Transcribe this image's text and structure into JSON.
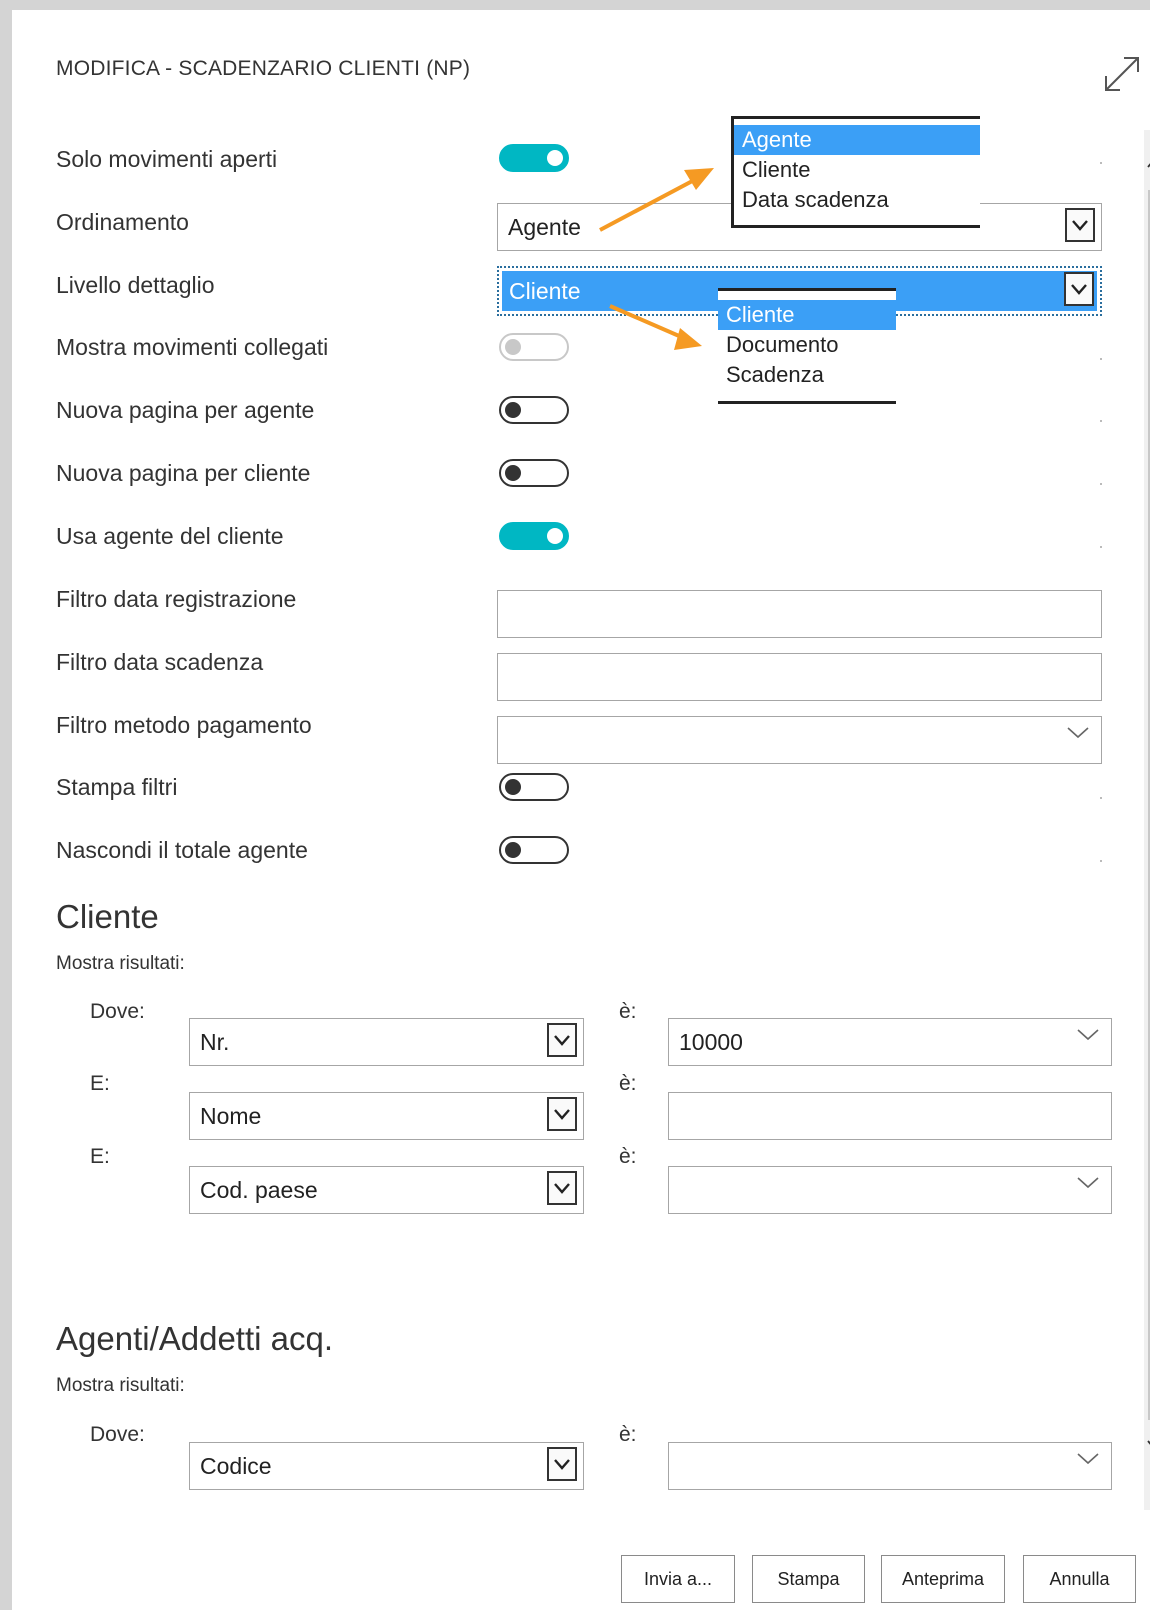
{
  "dialog": {
    "title": "MODIFICA - SCADENZARIO CLIENTI (NP)"
  },
  "options": {
    "solo_movimenti_aperti": {
      "label": "Solo movimenti aperti",
      "state": "on"
    },
    "ordinamento": {
      "label": "Ordinamento",
      "value": "Agente",
      "options": [
        "Agente",
        "Cliente",
        "Data scadenza"
      ],
      "highlighted": "Agente"
    },
    "livello_dettaglio": {
      "label": "Livello dettaglio",
      "value": "Cliente",
      "options": [
        "Cliente",
        "Documento",
        "Scadenza"
      ],
      "highlighted": "Cliente"
    },
    "mostra_movimenti_collegati": {
      "label": "Mostra movimenti collegati",
      "state": "disabled"
    },
    "nuova_pagina_per_agente": {
      "label": "Nuova pagina per agente",
      "state": "off"
    },
    "nuova_pagina_per_cliente": {
      "label": "Nuova pagina per cliente",
      "state": "off"
    },
    "usa_agente_del_cliente": {
      "label": "Usa agente del cliente",
      "state": "on"
    },
    "filtro_data_registrazione": {
      "label": "Filtro data registrazione",
      "value": ""
    },
    "filtro_data_scadenza": {
      "label": "Filtro data scadenza",
      "value": ""
    },
    "filtro_metodo_pagamento": {
      "label": "Filtro metodo pagamento",
      "value": ""
    },
    "stampa_filtri": {
      "label": "Stampa filtri",
      "state": "off"
    },
    "nascondi_totale_agente": {
      "label": "Nascondi il totale agente",
      "state": "off"
    }
  },
  "cliente": {
    "heading": "Cliente",
    "show_results": "Mostra risultati:",
    "filters": [
      {
        "conj": "Dove:",
        "field": "Nr.",
        "is": "è:",
        "value": "10000"
      },
      {
        "conj": "E:",
        "field": "Nome",
        "is": "è:",
        "value": ""
      },
      {
        "conj": "E:",
        "field": "Cod. paese",
        "is": "è:",
        "value": ""
      }
    ]
  },
  "agenti": {
    "heading": "Agenti/Addetti acq.",
    "show_results": "Mostra risultati:",
    "filters": [
      {
        "conj": "Dove:",
        "field": "Codice",
        "is": "è:",
        "value": ""
      }
    ]
  },
  "buttons": {
    "send": "Invia a...",
    "print": "Stampa",
    "preview": "Anteprima",
    "cancel": "Annulla"
  },
  "colors": {
    "toggle_on": "#00b7c3",
    "selection": "#3b9ff6",
    "annotation_arrow": "#f59a23"
  },
  "icons": [
    "expand-icon",
    "chevron-down-icon",
    "dropdown-arrow-icon",
    "scroll-up-icon",
    "scroll-down-icon"
  ]
}
